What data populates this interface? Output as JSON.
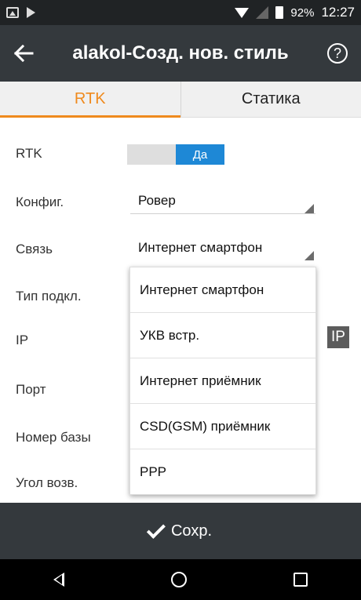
{
  "status_bar": {
    "battery_percent": "92%",
    "time": "12:27",
    "icons": [
      "image-icon",
      "play-icon",
      "wifi-icon",
      "signal-icon",
      "battery-icon"
    ]
  },
  "app_bar": {
    "back_icon": "arrow-left-icon",
    "title": "alakol-Созд. нов. стиль",
    "help_glyph": "?"
  },
  "tabs": [
    {
      "label": "RTK",
      "active": true
    },
    {
      "label": "Статика",
      "active": false
    }
  ],
  "form": {
    "rtk": {
      "label": "RTK",
      "toggle_value": "Да"
    },
    "config": {
      "label": "Конфиг.",
      "value": "Ровер"
    },
    "link": {
      "label": "Связь",
      "value": "Интернет смартфон"
    },
    "conn_type": {
      "label": "Тип подкл."
    },
    "ip": {
      "label": "IP",
      "button_label": "IP"
    },
    "port": {
      "label": "Порт"
    },
    "base_number": {
      "label": "Номер базы"
    },
    "elev_angle": {
      "label": "Угол возв."
    }
  },
  "dropdown": {
    "options": [
      "Интернет смартфон",
      "УКВ встр.",
      "Интернет приёмник",
      "CSD(GSM) приёмник",
      "PPP"
    ]
  },
  "save_bar": {
    "label": "Сохр."
  },
  "colors": {
    "accent": "#ef8a1d",
    "toggle_on": "#1e88d6",
    "appbar": "#34393d"
  }
}
